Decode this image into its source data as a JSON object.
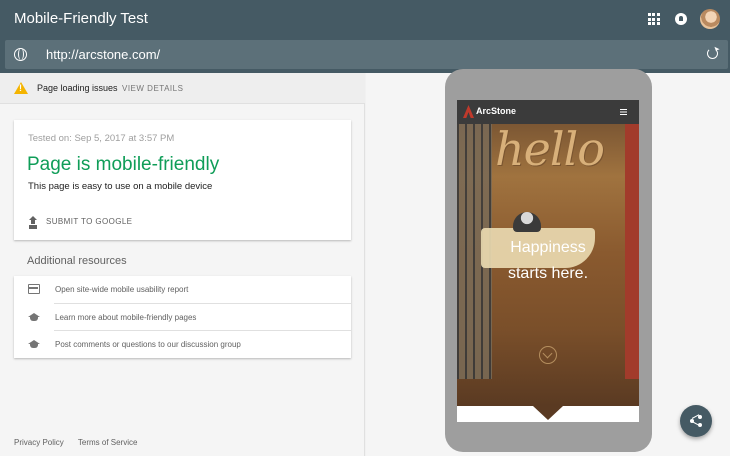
{
  "header": {
    "title": "Mobile-Friendly Test",
    "icons": [
      "apps-grid-icon",
      "notifications-icon",
      "account-avatar"
    ]
  },
  "urlbar": {
    "value": "http://arcstone.com/"
  },
  "issues": {
    "label": "Page loading issues",
    "action": "VIEW DETAILS"
  },
  "result": {
    "tested_on": "Tested on: Sep 5, 2017 at 3:57 PM",
    "title": "Page is mobile-friendly",
    "description": "This page is easy to use on a mobile device",
    "submit_label": "SUBMIT TO GOOGLE"
  },
  "resources": {
    "title": "Additional resources",
    "items": [
      {
        "label": "Open site-wide mobile usability report",
        "icon": "report-icon"
      },
      {
        "label": "Learn more about mobile-friendly pages",
        "icon": "school-icon"
      },
      {
        "label": "Post comments or questions to our discussion group",
        "icon": "school-icon"
      }
    ]
  },
  "footer": {
    "privacy": "Privacy Policy",
    "terms": "Terms of Service"
  },
  "preview": {
    "site_name": "ArcStone",
    "hero_word": "hello",
    "headline_line1": "Happiness",
    "headline_line2": "starts here."
  },
  "colors": {
    "header_bg": "#455a64",
    "success_green": "#0f9d58",
    "warning_yellow": "#f4b400"
  }
}
